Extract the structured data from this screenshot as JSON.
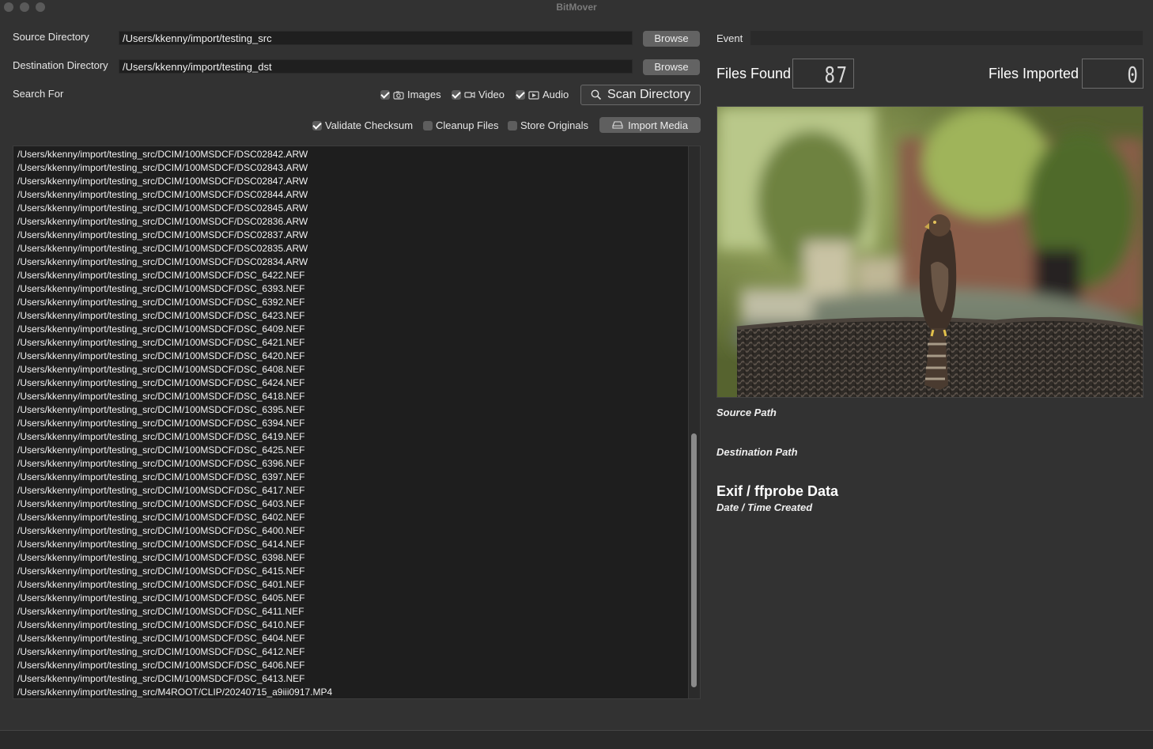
{
  "window": {
    "title": "BitMover"
  },
  "source": {
    "label": "Source Directory",
    "value": "/Users/kkenny/import/testing_src",
    "browse": "Browse"
  },
  "destination": {
    "label": "Destination Directory",
    "value": "/Users/kkenny/import/testing_dst",
    "browse": "Browse"
  },
  "search": {
    "label": "Search For",
    "images": {
      "label": "Images",
      "checked": true
    },
    "video": {
      "label": "Video",
      "checked": true
    },
    "audio": {
      "label": "Audio",
      "checked": true
    },
    "scan_button": "Scan Directory"
  },
  "options": {
    "validate_checksum": {
      "label": "Validate Checksum",
      "checked": true
    },
    "cleanup_files": {
      "label": "Cleanup Files",
      "checked": false
    },
    "store_originals": {
      "label": "Store Originals",
      "checked": false
    },
    "import_button": "Import Media"
  },
  "event": {
    "label": "Event",
    "value": ""
  },
  "counters": {
    "files_found_label": "Files Found",
    "files_found_value": "87",
    "files_imported_label": "Files Imported",
    "files_imported_value": "0"
  },
  "details": {
    "source_path_label": "Source Path",
    "destination_path_label": "Destination Path",
    "exif_heading": "Exif / ffprobe Data",
    "date_label": "Date / Time Created"
  },
  "files": [
    "/Users/kkenny/import/testing_src/DCIM/100MSDCF/DSC02842.ARW",
    "/Users/kkenny/import/testing_src/DCIM/100MSDCF/DSC02843.ARW",
    "/Users/kkenny/import/testing_src/DCIM/100MSDCF/DSC02847.ARW",
    "/Users/kkenny/import/testing_src/DCIM/100MSDCF/DSC02844.ARW",
    "/Users/kkenny/import/testing_src/DCIM/100MSDCF/DSC02845.ARW",
    "/Users/kkenny/import/testing_src/DCIM/100MSDCF/DSC02836.ARW",
    "/Users/kkenny/import/testing_src/DCIM/100MSDCF/DSC02837.ARW",
    "/Users/kkenny/import/testing_src/DCIM/100MSDCF/DSC02835.ARW",
    "/Users/kkenny/import/testing_src/DCIM/100MSDCF/DSC02834.ARW",
    "/Users/kkenny/import/testing_src/DCIM/100MSDCF/DSC_6422.NEF",
    "/Users/kkenny/import/testing_src/DCIM/100MSDCF/DSC_6393.NEF",
    "/Users/kkenny/import/testing_src/DCIM/100MSDCF/DSC_6392.NEF",
    "/Users/kkenny/import/testing_src/DCIM/100MSDCF/DSC_6423.NEF",
    "/Users/kkenny/import/testing_src/DCIM/100MSDCF/DSC_6409.NEF",
    "/Users/kkenny/import/testing_src/DCIM/100MSDCF/DSC_6421.NEF",
    "/Users/kkenny/import/testing_src/DCIM/100MSDCF/DSC_6420.NEF",
    "/Users/kkenny/import/testing_src/DCIM/100MSDCF/DSC_6408.NEF",
    "/Users/kkenny/import/testing_src/DCIM/100MSDCF/DSC_6424.NEF",
    "/Users/kkenny/import/testing_src/DCIM/100MSDCF/DSC_6418.NEF",
    "/Users/kkenny/import/testing_src/DCIM/100MSDCF/DSC_6395.NEF",
    "/Users/kkenny/import/testing_src/DCIM/100MSDCF/DSC_6394.NEF",
    "/Users/kkenny/import/testing_src/DCIM/100MSDCF/DSC_6419.NEF",
    "/Users/kkenny/import/testing_src/DCIM/100MSDCF/DSC_6425.NEF",
    "/Users/kkenny/import/testing_src/DCIM/100MSDCF/DSC_6396.NEF",
    "/Users/kkenny/import/testing_src/DCIM/100MSDCF/DSC_6397.NEF",
    "/Users/kkenny/import/testing_src/DCIM/100MSDCF/DSC_6417.NEF",
    "/Users/kkenny/import/testing_src/DCIM/100MSDCF/DSC_6403.NEF",
    "/Users/kkenny/import/testing_src/DCIM/100MSDCF/DSC_6402.NEF",
    "/Users/kkenny/import/testing_src/DCIM/100MSDCF/DSC_6400.NEF",
    "/Users/kkenny/import/testing_src/DCIM/100MSDCF/DSC_6414.NEF",
    "/Users/kkenny/import/testing_src/DCIM/100MSDCF/DSC_6398.NEF",
    "/Users/kkenny/import/testing_src/DCIM/100MSDCF/DSC_6415.NEF",
    "/Users/kkenny/import/testing_src/DCIM/100MSDCF/DSC_6401.NEF",
    "/Users/kkenny/import/testing_src/DCIM/100MSDCF/DSC_6405.NEF",
    "/Users/kkenny/import/testing_src/DCIM/100MSDCF/DSC_6411.NEF",
    "/Users/kkenny/import/testing_src/DCIM/100MSDCF/DSC_6410.NEF",
    "/Users/kkenny/import/testing_src/DCIM/100MSDCF/DSC_6404.NEF",
    "/Users/kkenny/import/testing_src/DCIM/100MSDCF/DSC_6412.NEF",
    "/Users/kkenny/import/testing_src/DCIM/100MSDCF/DSC_6406.NEF",
    "/Users/kkenny/import/testing_src/DCIM/100MSDCF/DSC_6413.NEF",
    "/Users/kkenny/import/testing_src/M4ROOT/CLIP/20240715_a9iii0917.MP4"
  ],
  "scroll": {
    "thumb_start_fraction": 0.52,
    "thumb_size_fraction": 0.46
  },
  "icons": {
    "images": "camera-icon",
    "video": "video-camera-icon",
    "audio": "audio-icon",
    "scan": "magnifier-icon",
    "import": "drive-icon"
  },
  "colors": {
    "background": "#323232",
    "field": "#1f1f1f",
    "button": "#636363",
    "list": "#1e1e1e"
  }
}
